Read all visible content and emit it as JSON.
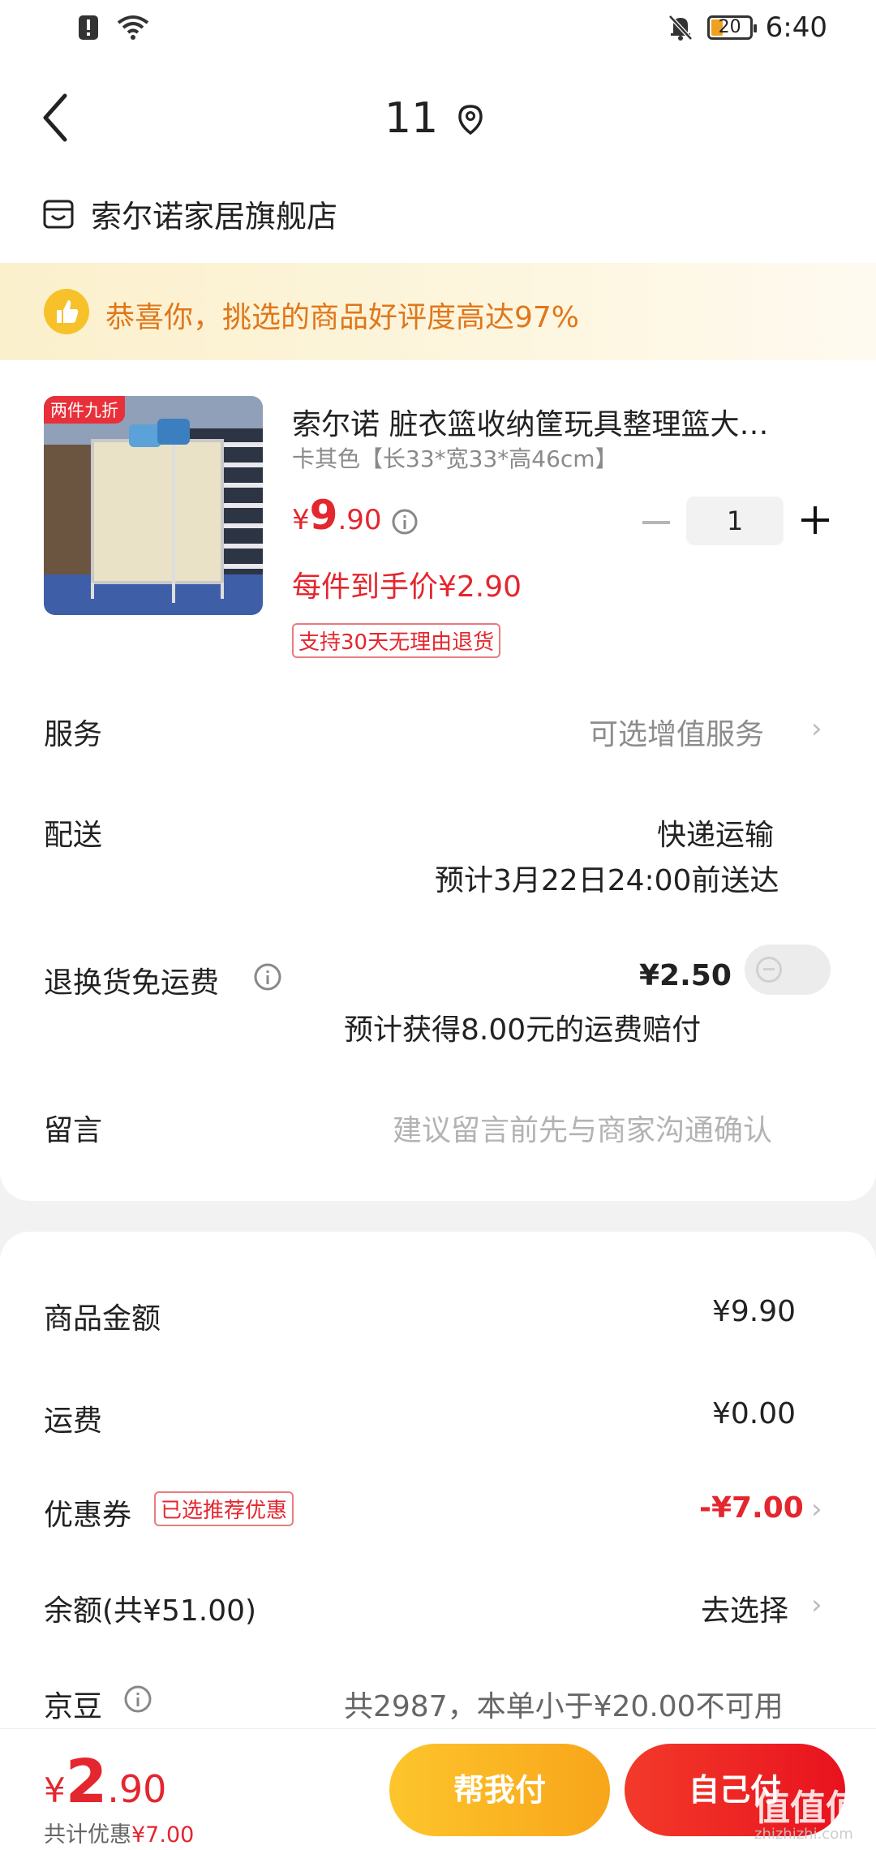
{
  "status_bar": {
    "time": "6:40",
    "battery": "20"
  },
  "nav": {
    "title": "11"
  },
  "store": {
    "name": "索尔诺家居旗舰店"
  },
  "banner": {
    "text": "恭喜你，挑选的商品好评度高达97%"
  },
  "product": {
    "badge": "两件九折",
    "title": "索尔诺 脏衣篮收纳筐玩具整理篮大…",
    "spec": "卡其色【长33*宽33*高46cm】",
    "price_symbol": "¥",
    "price_int": "9",
    "price_dec": ".90",
    "each_price": "每件到手价¥2.90",
    "return_tag": "支持30天无理由退货",
    "quantity": "1"
  },
  "rows": {
    "service_label": "服务",
    "service_value": "可选增值服务",
    "delivery_label": "配送",
    "delivery_value": "快递运输",
    "delivery_eta": "预计3月22日24:00前送达",
    "return_fee_label": "退换货免运费",
    "return_fee_value": "¥2.50",
    "return_fee_note": "预计获得8.00元的运费赔付",
    "message_label": "留言",
    "message_placeholder": "建议留言前先与商家沟通确认"
  },
  "summary": {
    "goods_amount_label": "商品金额",
    "goods_amount_value": "¥9.90",
    "shipping_label": "运费",
    "shipping_value": "¥0.00",
    "coupon_label": "优惠券",
    "coupon_tag": "已选推荐优惠",
    "coupon_value": "-¥7.00",
    "balance_label": "余额(共¥51.00)",
    "balance_value": "去选择",
    "jingdou_label": "京豆",
    "jingdou_value": "共2987，本单小于¥20.00不可用"
  },
  "bottom": {
    "total_symbol": "¥",
    "total_int": "2",
    "total_dec": ".90",
    "saving_prefix": "共计优惠",
    "saving_value": "¥7.00",
    "help_pay_label": "帮我付",
    "self_pay_label": "自己付"
  },
  "watermark": {
    "text": "值值值",
    "sub": "zhizhizhi.com"
  },
  "colors": {
    "accent_red": "#e4262e",
    "accent_orange": "#e0771b",
    "help_btn": "#fdc52c"
  }
}
